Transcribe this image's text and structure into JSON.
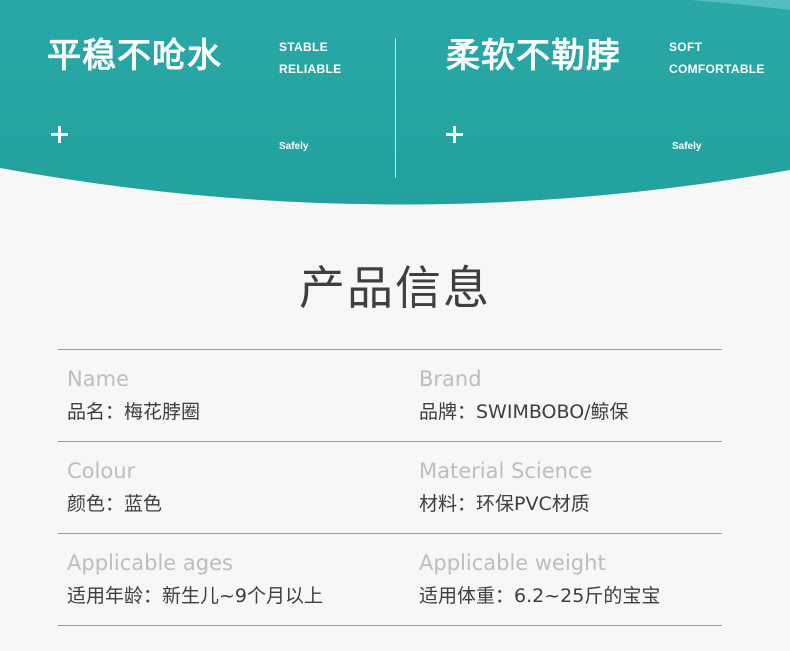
{
  "colors": {
    "banner_teal": "#2aa7a6",
    "banner_highlight": "#5ec9c7",
    "background": "#f7f7f7",
    "title_text": "#3f3f3f",
    "label_en": "#bdbdbd",
    "label_zh": "#3e3e3e",
    "rule": "#9c9c9c"
  },
  "banner": {
    "features": [
      {
        "title": "平稳不呛水",
        "en_line1": "STABLE",
        "en_line2": "RELIABLE",
        "icon": "plus-icon",
        "tag": "Safely"
      },
      {
        "title": "柔软不勒脖",
        "en_line1": "SOFT",
        "en_line2": "COMFORTABLE",
        "icon": "plus-icon",
        "tag": "Safely"
      }
    ]
  },
  "section": {
    "title": "产品信息"
  },
  "info": {
    "rows": [
      {
        "left": {
          "en": "Name",
          "zh": "品名：梅花脖圈"
        },
        "right": {
          "en": "Brand",
          "zh": "品牌：SWIMBOBO/鲸保"
        }
      },
      {
        "left": {
          "en": "Colour",
          "zh": "颜色：蓝色"
        },
        "right": {
          "en": "Material Science",
          "zh": "材料：环保PVC材质"
        }
      },
      {
        "left": {
          "en": "Applicable ages",
          "zh": "适用年龄：新生儿~9个月以上"
        },
        "right": {
          "en": "Applicable weight",
          "zh": "适用体重：6.2~25斤的宝宝"
        }
      }
    ]
  }
}
